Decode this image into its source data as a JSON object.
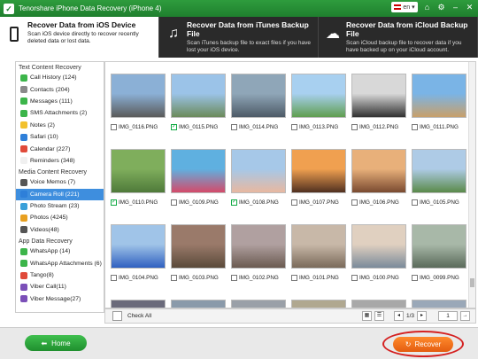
{
  "app": {
    "title": "Tenorshare iPhone Data Recovery (iPhone 4)",
    "language": "en"
  },
  "modes": [
    {
      "title": "Recover Data from iOS Device",
      "desc": "Scan iOS device directly to recover recently deleted data or lost data.",
      "active": true
    },
    {
      "title": "Recover Data from iTunes Backup File",
      "desc": "Scan iTunes backup file to exact files if you have lost your iOS device.",
      "active": false
    },
    {
      "title": "Recover Data from iCloud Backup File",
      "desc": "Scan iCloud backup file to recover data if you have backed up on your iCloud account.",
      "active": false
    }
  ],
  "sidebar": {
    "cat_text": "Text Content Recovery",
    "text_items": [
      {
        "label": "Call History (124)",
        "color": "#3cb54a"
      },
      {
        "label": "Contacts (204)",
        "color": "#8a8a8a"
      },
      {
        "label": "Messages (111)",
        "color": "#3cb54a"
      },
      {
        "label": "SMS Attachments (2)",
        "color": "#3cb54a"
      },
      {
        "label": "Notes (2)",
        "color": "#f2c12e"
      },
      {
        "label": "Safari (10)",
        "color": "#2e7fd9"
      },
      {
        "label": "Calendar (227)",
        "color": "#e04a3a"
      },
      {
        "label": "Reminders (348)",
        "color": "#f0f0f0"
      }
    ],
    "cat_media": "Media Content Recovery",
    "media_items": [
      {
        "label": "Voice Memos (7)",
        "color": "#555555"
      },
      {
        "label": "Camera Roll (221)",
        "color": "#2e7fd9",
        "selected": true
      },
      {
        "label": "Photo Stream (23)",
        "color": "#3aa0d9"
      },
      {
        "label": "Photos (4245)",
        "color": "#e8a020"
      },
      {
        "label": "Videos(48)",
        "color": "#555555"
      }
    ],
    "cat_app": "App Data Recovery",
    "app_items": [
      {
        "label": "WhatsApp (14)",
        "color": "#3cb54a"
      },
      {
        "label": "WhatsApp Attachments (6)",
        "color": "#3cb54a"
      },
      {
        "label": "Tango(8)",
        "color": "#e04a3a"
      },
      {
        "label": "Viber Call(11)",
        "color": "#7b4fb8"
      },
      {
        "label": "Viber Message(27)",
        "color": "#7b4fb8"
      }
    ]
  },
  "photos": [
    {
      "name": "IMG_0116.PNG",
      "checked": false,
      "c1": "#8bb0d6",
      "c2": "#5a5a5a"
    },
    {
      "name": "IMG_0115.PNG",
      "checked": true,
      "c1": "#9bc3e8",
      "c2": "#6b8a5a"
    },
    {
      "name": "IMG_0114.PNG",
      "checked": false,
      "c1": "#8fa6b8",
      "c2": "#4d5a66"
    },
    {
      "name": "IMG_0113.PNG",
      "checked": false,
      "c1": "#a8d0f0",
      "c2": "#5f9e4f"
    },
    {
      "name": "IMG_0112.PNG",
      "checked": false,
      "c1": "#d8d8d8",
      "c2": "#303030"
    },
    {
      "name": "IMG_0111.PNG",
      "checked": false,
      "c1": "#7ab4e6",
      "c2": "#c9a06a"
    },
    {
      "name": "IMG_0110.PNG",
      "checked": true,
      "c1": "#7fae5c",
      "c2": "#4f7a3a"
    },
    {
      "name": "IMG_0109.PNG",
      "checked": false,
      "c1": "#5fb0e0",
      "c2": "#d44a6a"
    },
    {
      "name": "IMG_0108.PNG",
      "checked": true,
      "c1": "#a6c8e8",
      "c2": "#e8b8a0"
    },
    {
      "name": "IMG_0107.PNG",
      "checked": false,
      "c1": "#f0a050",
      "c2": "#503020"
    },
    {
      "name": "IMG_0106.PNG",
      "checked": false,
      "c1": "#e8b07a",
      "c2": "#7a4a30"
    },
    {
      "name": "IMG_0105.PNG",
      "checked": false,
      "c1": "#aecbe6",
      "c2": "#5a8a4a"
    },
    {
      "name": "IMG_0104.PNG",
      "checked": false,
      "c1": "#a0c4e8",
      "c2": "#3060c0"
    },
    {
      "name": "IMG_0103.PNG",
      "checked": false,
      "c1": "#9a7a6a",
      "c2": "#5a4a3a"
    },
    {
      "name": "IMG_0102.PNG",
      "checked": false,
      "c1": "#b0a0a0",
      "c2": "#6a5a50"
    },
    {
      "name": "IMG_0101.PNG",
      "checked": false,
      "c1": "#c8b8a8",
      "c2": "#7a6a5a"
    },
    {
      "name": "IMG_0100.PNG",
      "checked": false,
      "c1": "#e0d0c0",
      "c2": "#7a8a9a"
    },
    {
      "name": "IMG_0099.PNG",
      "checked": false,
      "c1": "#a8b8a8",
      "c2": "#5a6a5a"
    },
    {
      "name": "",
      "checked": false,
      "c1": "#6a6a7a",
      "c2": "#3a3a4a"
    },
    {
      "name": "",
      "checked": false,
      "c1": "#8a9aaa",
      "c2": "#4a5a6a"
    },
    {
      "name": "",
      "checked": false,
      "c1": "#9aa0a8",
      "c2": "#5a6068"
    },
    {
      "name": "",
      "checked": false,
      "c1": "#b0a890",
      "c2": "#706850"
    },
    {
      "name": "",
      "checked": false,
      "c1": "#a8a8a8",
      "c2": "#686868"
    },
    {
      "name": "",
      "checked": false,
      "c1": "#9aa8b8",
      "c2": "#5a6878"
    }
  ],
  "bottom": {
    "check_all": "Check All",
    "page_label": "1/3",
    "page_input": "1"
  },
  "footer": {
    "home_label": "Home",
    "recover_label": "Recover"
  }
}
